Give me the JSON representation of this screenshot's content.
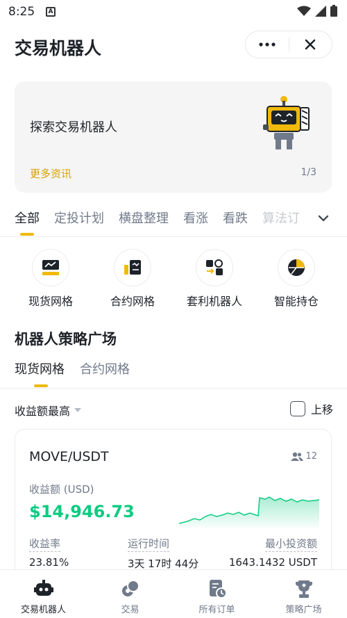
{
  "status": {
    "time": "8:25",
    "notif": "A"
  },
  "header": {
    "title": "交易机器人"
  },
  "banner": {
    "title": "探索交易机器人",
    "link": "更多资讯",
    "page": "1/3"
  },
  "categories": [
    "全部",
    "定投计划",
    "横盘整理",
    "看涨",
    "看跌",
    "算法订"
  ],
  "quick": [
    {
      "label": "现货网格",
      "icon": "spot-grid-icon"
    },
    {
      "label": "合约网格",
      "icon": "futures-grid-icon"
    },
    {
      "label": "套利机器人",
      "icon": "arbitrage-bot-icon"
    },
    {
      "label": "智能持仓",
      "icon": "smart-position-icon"
    }
  ],
  "section": {
    "title": "机器人策略广场",
    "tabs": [
      "现货网格",
      "合约网格"
    ]
  },
  "filter": {
    "sort": "收益额最高",
    "upmove": "上移"
  },
  "card": {
    "pair": "MOVE/USDT",
    "users": "12",
    "profit_label": "收益额 (USD)",
    "profit_value": "$14,946.73",
    "rate_label": "收益率",
    "rate_value": "23.81%",
    "runtime_label": "运行时间",
    "runtime_value": "3天 17时 44分",
    "min_label": "最小投资额",
    "min_value": "1643.1432 USDT"
  },
  "nav": [
    {
      "label": "交易机器人",
      "icon": "robot-icon",
      "active": true
    },
    {
      "label": "交易",
      "icon": "trade-icon",
      "active": false
    },
    {
      "label": "所有订单",
      "icon": "orders-icon",
      "active": false
    },
    {
      "label": "策略广场",
      "icon": "trophy-icon",
      "active": false
    }
  ],
  "colors": {
    "accent": "#f0b90b",
    "positive": "#0ecb81",
    "text": "#1e2329",
    "muted": "#707a8a"
  }
}
